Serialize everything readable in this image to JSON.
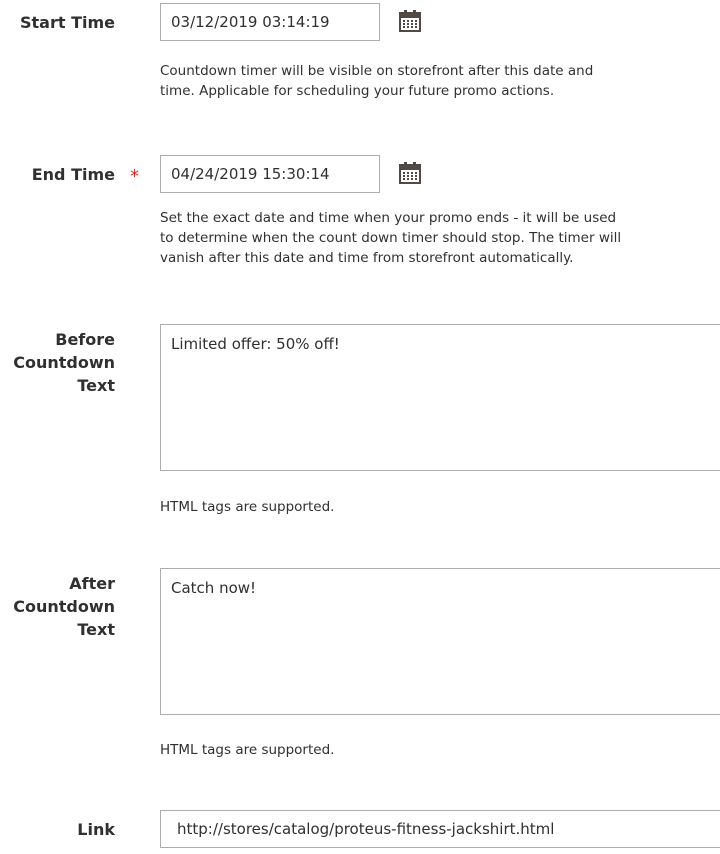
{
  "fields": {
    "start_time": {
      "label": "Start Time",
      "value": "03/12/2019 03:14:19",
      "note_line1": "Countdown timer will be visible on storefront after this date and",
      "note_line2": "time. Applicable for scheduling your future promo actions."
    },
    "end_time": {
      "label": "End Time",
      "required_mark": "*",
      "value": "04/24/2019 15:30:14",
      "note_line1": "Set the exact date and time when your promo ends - it will be used",
      "note_line2": "to determine when the count down timer should stop. The timer will",
      "note_line3": "vanish after this date and time from storefront automatically."
    },
    "before_text": {
      "label_line1": "Before",
      "label_line2": "Countdown",
      "label_line3": "Text",
      "value": "Limited offer: 50% off!",
      "note": "HTML tags are supported."
    },
    "after_text": {
      "label_line1": "After",
      "label_line2": "Countdown",
      "label_line3": "Text",
      "value": "Catch now!",
      "note": "HTML tags are supported."
    },
    "link": {
      "label": "Link",
      "value": "http://stores/catalog/proteus-fitness-jackshirt.html"
    }
  },
  "icons": {
    "calendar": "calendar-icon"
  }
}
